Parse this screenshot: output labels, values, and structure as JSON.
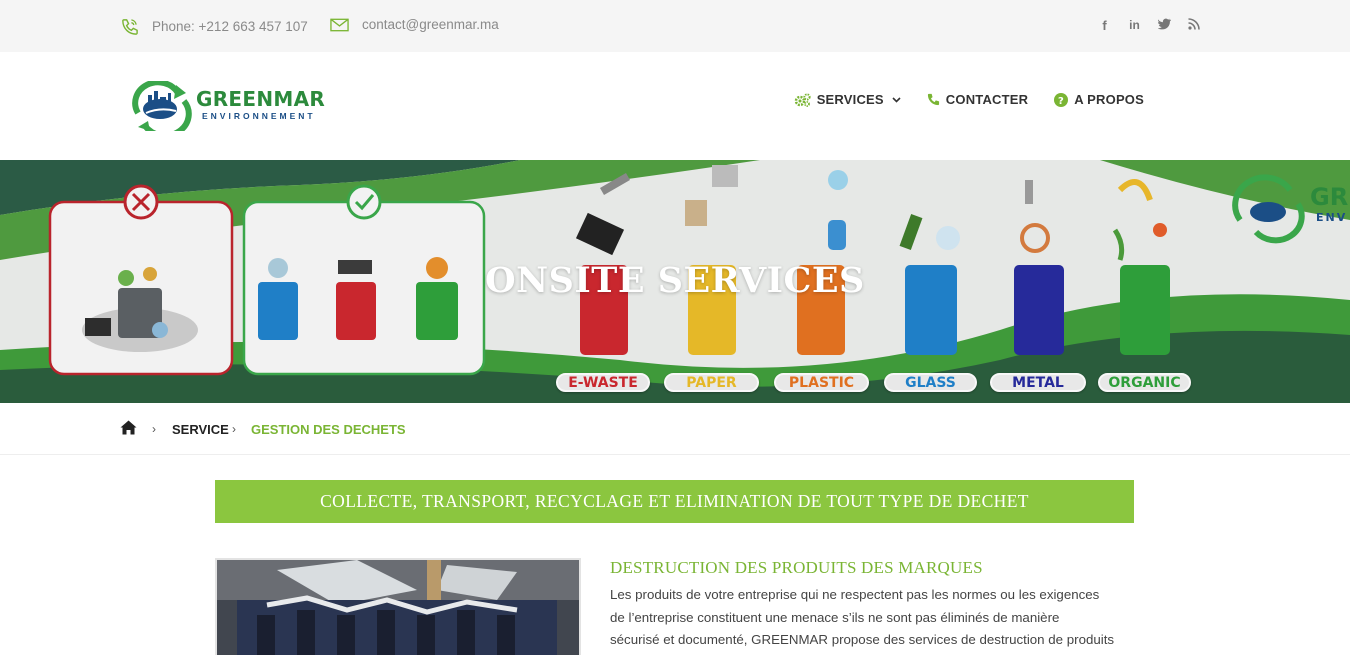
{
  "topbar": {
    "phone": "Phone: +212 663 457 107",
    "email": "contact@greenmar.ma",
    "social": [
      {
        "icon": "facebook-icon",
        "glyph": "f"
      },
      {
        "icon": "linkedin-icon",
        "glyph": "in"
      },
      {
        "icon": "twitter-icon",
        "glyph": "t"
      },
      {
        "icon": "rss-icon",
        "glyph": "rss"
      }
    ]
  },
  "header": {
    "logo_text": "GREENMAR",
    "logo_subtext": "ENVIRONNEMENT",
    "nav": {
      "services": "SERVICES",
      "contact": "CONTACTER",
      "about": "A PROPOS"
    }
  },
  "banner": {
    "title": "ONSITE SERVICES",
    "bin_labels": {
      "ewaste": "E-WASTE",
      "paper": "PAPER",
      "plastic": "PLASTIC",
      "glass": "GLASS",
      "metal": "METAL",
      "organic": "ORGANIC"
    },
    "logo_fragment": "GR",
    "logo_fragment_sub": "ENV"
  },
  "breadcrumb": {
    "level1": "SERVICE",
    "current": "GESTION DES DECHETS"
  },
  "main": {
    "section_title": "COLLECTE, TRANSPORT, RECYCLAGE ET ELIMINATION DE TOUT TYPE DE DECHET",
    "article_title": "DESTRUCTION DES PRODUITS DES MARQUES",
    "body_lines": [
      "Les produits de votre entreprise qui ne respectent pas les normes ou les exigences",
      "de l’entreprise constituent une menace s’ils ne sont pas éliminés de manière",
      "sécurisé et documenté, GREENMAR propose des services de destruction de produits"
    ]
  },
  "colors": {
    "brand_green": "#8bc63f",
    "dark_green": "#2c8a3c",
    "nav_icon_green": "#7ab534"
  }
}
